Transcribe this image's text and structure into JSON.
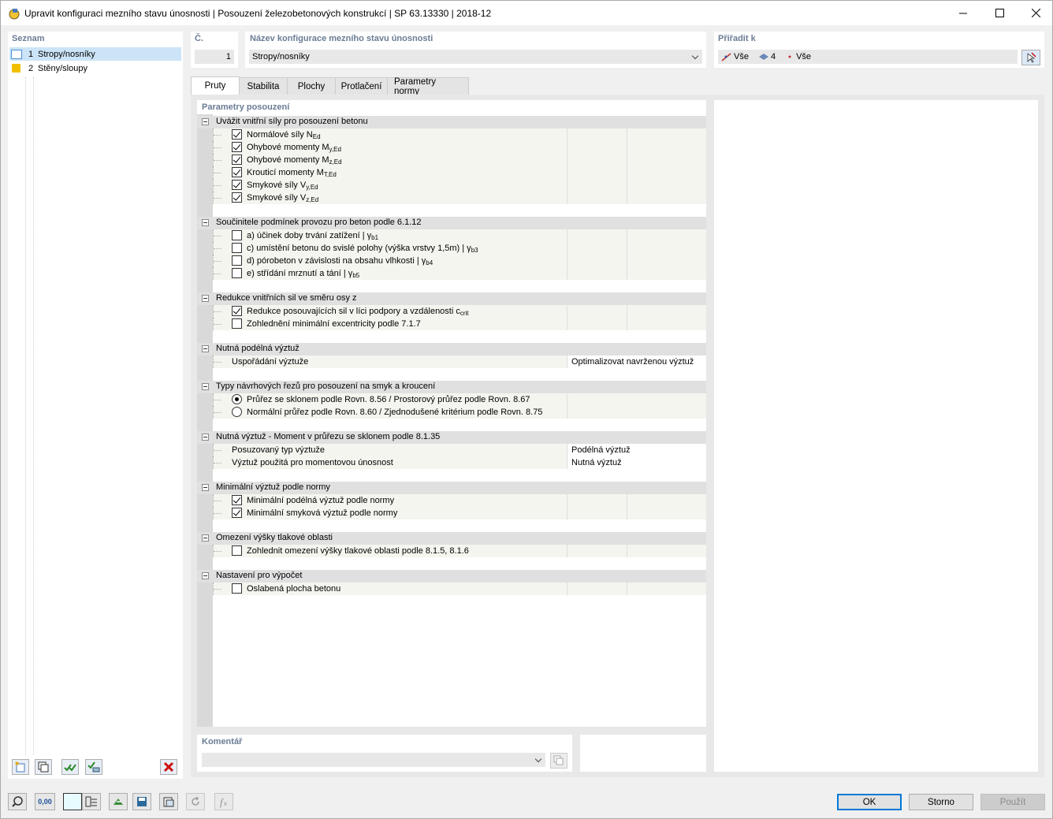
{
  "window": {
    "title": "Upravit konfiguraci mezního stavu únosnosti | Posouzení železobetonových konstrukcí | SP 63.13330 | 2018-12"
  },
  "list": {
    "label": "Seznam",
    "items": [
      {
        "num": "1",
        "label": "Stropy/nosníky",
        "color": "#ffffff",
        "selected": true
      },
      {
        "num": "2",
        "label": "Stěny/sloupy",
        "color": "#f0c000",
        "selected": false
      }
    ]
  },
  "header": {
    "no_label": "Č.",
    "no_value": "1",
    "name_label": "Název konfigurace mezního stavu únosnosti",
    "name_value": "Stropy/nosníky",
    "assign_label": "Přiřadit k",
    "assign_members": "Vše",
    "assign_surfaces": "4",
    "assign_nodes": "Vše"
  },
  "tabs": [
    "Pruty",
    "Stabilita",
    "Plochy",
    "Protlačení",
    "Parametry normy"
  ],
  "active_tab": 0,
  "params_label": "Parametry posouzení",
  "groups": {
    "g1": {
      "title": "Uvážit vnitřní síly pro posouzení betonu",
      "r1": "Normálové síly N",
      "r1s": "Ed",
      "r2": "Ohybové momenty M",
      "r2s": "y,Ed",
      "r3": "Ohybové momenty M",
      "r3s": "z,Ed",
      "r4": "Krouticí momenty M",
      "r4s": "T,Ed",
      "r5": "Smykové síly V",
      "r5s": "y,Ed",
      "r6": "Smykové síly V",
      "r6s": "z,Ed"
    },
    "g2": {
      "title": "Součinitele podmínek provozu pro beton podle 6.1.12",
      "r1": "a) účinek doby trvání zatížení | γ",
      "r1s": "b1",
      "r2": "c) umístění betonu do svislé polohy (výška vrstvy 1,5m) | γ",
      "r2s": "b3",
      "r3": "d) pórobeton v závislosti na obsahu vlhkosti | γ",
      "r3s": "b4",
      "r4": "e) střídání mrznutí a tání | γ",
      "r4s": "b5"
    },
    "g3": {
      "title": "Redukce vnitřních sil ve směru osy z",
      "r1": "Redukce posouvajících sil v líci podpory a vzdálenosti c",
      "r1s": "crit",
      "r2": "Zohlednění minimální excentricity podle 7.1.7"
    },
    "g4": {
      "title": "Nutná podélná výztuž",
      "r1": "Uspořádání výztuže",
      "r1v": "Optimalizovat navrženou výztuž"
    },
    "g5": {
      "title": "Typy návrhových řezů pro posouzení na smyk a kroucení",
      "r1": "Průřez se sklonem podle Rovn. 8.56 / Prostorový průřez podle Rovn. 8.67",
      "r2": "Normální průřez podle Rovn. 8.60 / Zjednodušené kritérium podle Rovn. 8.75"
    },
    "g6": {
      "title": "Nutná výztuž - Moment v průřezu se sklonem podle 8.1.35",
      "r1": "Posuzovaný typ výztuže",
      "r1v": "Podélná výztuž",
      "r2": "Výztuž použitá pro momentovou únosnost",
      "r2v": "Nutná výztuž"
    },
    "g7": {
      "title": "Minimální výztuž podle normy",
      "r1": "Minimální podélná výztuž podle normy",
      "r2": "Minimální smyková výztuž podle normy"
    },
    "g8": {
      "title": "Omezení výšky tlakové oblasti",
      "r1": "Zohlednit omezení výšky tlakové oblasti podle 8.1.5, 8.1.6"
    },
    "g9": {
      "title": "Nastavení pro výpočet",
      "r1": "Oslabená plocha betonu"
    }
  },
  "comment": {
    "label": "Komentář",
    "value": ""
  },
  "buttons": {
    "ok": "OK",
    "cancel": "Storno",
    "apply": "Použít"
  },
  "toolbar": {
    "decimals": "0,00"
  }
}
